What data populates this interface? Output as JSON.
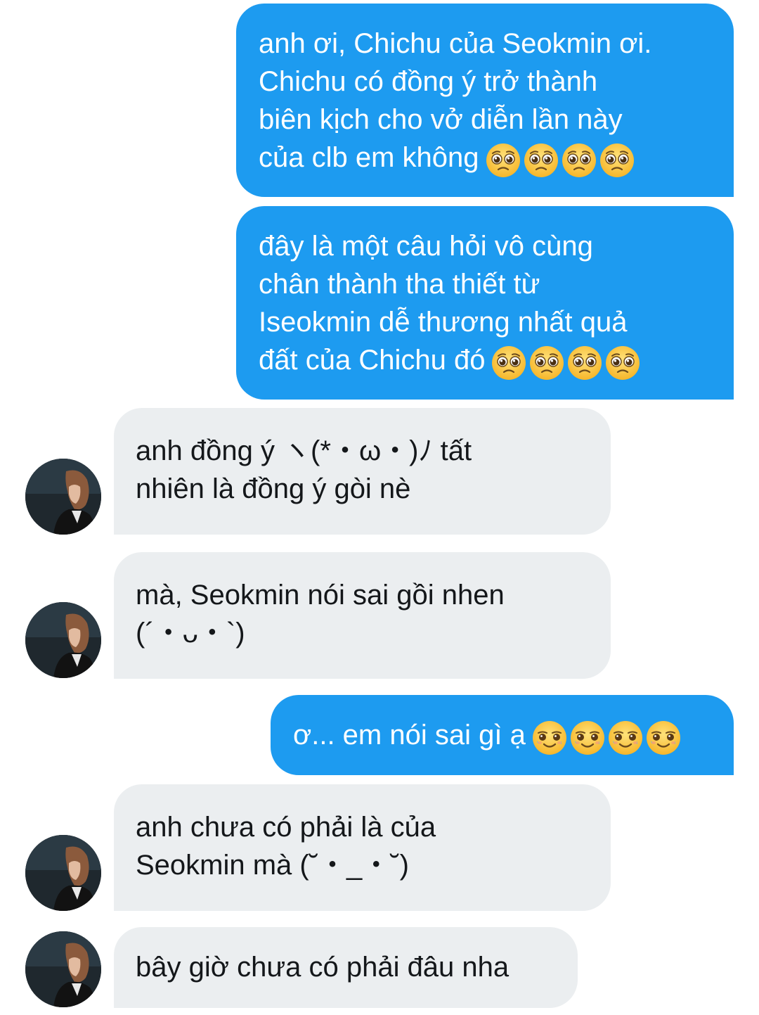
{
  "conversation": {
    "messages": [
      {
        "sender": "me",
        "lines": [
          "anh ơi, Chichu của Seokmin ơi.",
          "Chichu có đồng ý trở thành",
          "biên kịch cho vở diễn lần này",
          "của clb em không"
        ],
        "emoji": "pleading-face",
        "emoji_count": 4
      },
      {
        "sender": "me",
        "lines": [
          "đây là một câu hỏi vô cùng",
          "chân thành tha thiết từ",
          "Iseokmin dễ thương nhất quả",
          "đất của Chichu đó"
        ],
        "emoji": "pleading-face",
        "emoji_count": 4
      },
      {
        "sender": "other",
        "lines": [
          "anh đồng ý ヽ(*・ω・)ﾉ tất",
          "nhiên là đồng ý gòi nè"
        ]
      },
      {
        "sender": "other",
        "lines": [
          "mà, Seokmin nói sai gồi nhen",
          "(´・ᴗ・`)"
        ]
      },
      {
        "sender": "me",
        "lines": [
          "ơ... em nói sai gì ạ"
        ],
        "emoji": "smiling-face-with-tear",
        "emoji_count": 4
      },
      {
        "sender": "other",
        "lines": [
          "anh chưa có phải là của",
          "Seokmin mà (˘・_・˘)"
        ]
      },
      {
        "sender": "other",
        "lines": [
          "bây giờ chưa có phải đâu nha"
        ]
      }
    ]
  },
  "colors": {
    "sent_bubble": "#1d9bf0",
    "received_bubble": "#ebeef0",
    "sent_text": "#ffffff",
    "received_text": "#14171a"
  }
}
